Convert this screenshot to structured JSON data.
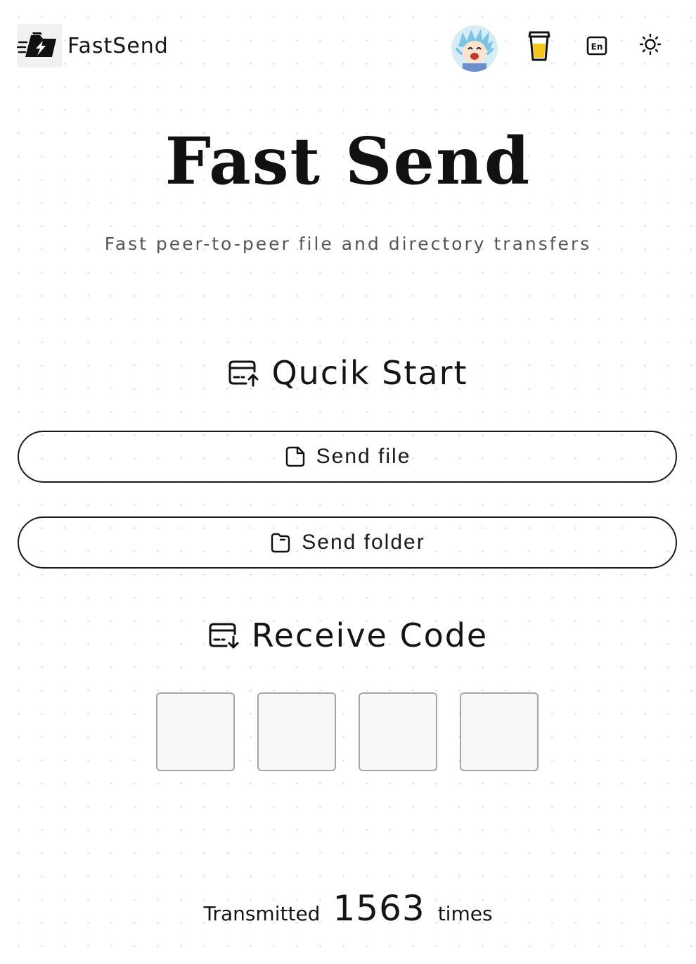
{
  "header": {
    "brand_name": "FastSend",
    "icons": {
      "logo": "lightning-folder-logo",
      "avatar": "anime-avatar",
      "sponsor": "coffee-cup-icon",
      "language": "en-language-icon",
      "theme": "sun-icon"
    },
    "language_code": "En"
  },
  "hero": {
    "title": "Fast Send",
    "subtitle": "Fast peer-to-peer file and directory transfers"
  },
  "quick_start": {
    "heading": "Qucik Start",
    "send_file_label": "Send file",
    "send_folder_label": "Send folder"
  },
  "receive": {
    "heading": "Receive Code",
    "code_values": [
      "",
      "",
      "",
      ""
    ]
  },
  "stats": {
    "prefix": "Transmitted",
    "count": "1563",
    "suffix": "times"
  },
  "colors": {
    "text": "#151515",
    "subtitle": "#555555",
    "border": "#1a1a1a",
    "input_border": "#a6a6a6",
    "input_bg": "#f8f8f8",
    "cup_fill": "#f5c518",
    "logo_bg": "#f1f1f1"
  }
}
